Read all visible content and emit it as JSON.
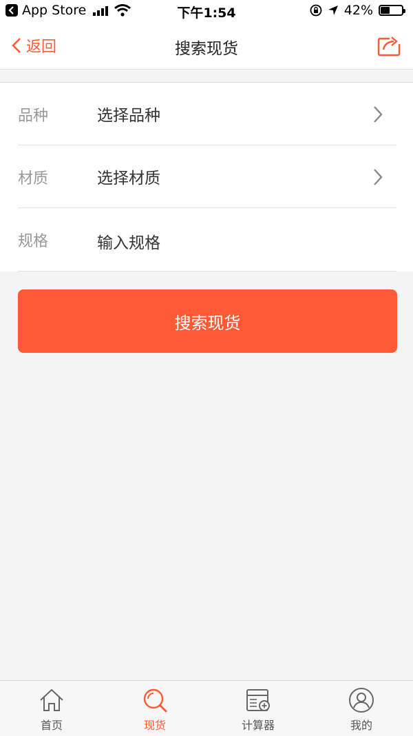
{
  "status_bar": {
    "back_app": "App Store",
    "time": "下午1:54",
    "battery": "42%",
    "battery_level": 0.42
  },
  "nav": {
    "back_label": "返回",
    "title": "搜索现货",
    "share_icon": "share-icon"
  },
  "form": {
    "rows": [
      {
        "label": "品种",
        "value": "选择品种",
        "chevron": true
      },
      {
        "label": "材质",
        "value": "选择材质",
        "chevron": true
      },
      {
        "label": "规格",
        "placeholder": "输入规格",
        "chevron": false
      }
    ]
  },
  "search_button": "搜索现货",
  "colors": {
    "accent": "#ff5a35",
    "background": "#f4f4f4"
  },
  "tabs": [
    {
      "label": "首页",
      "icon": "home-icon",
      "active": false
    },
    {
      "label": "现货",
      "icon": "search-icon",
      "active": true
    },
    {
      "label": "计算器",
      "icon": "calculator-icon",
      "active": false
    },
    {
      "label": "我的",
      "icon": "user-icon",
      "active": false
    }
  ]
}
